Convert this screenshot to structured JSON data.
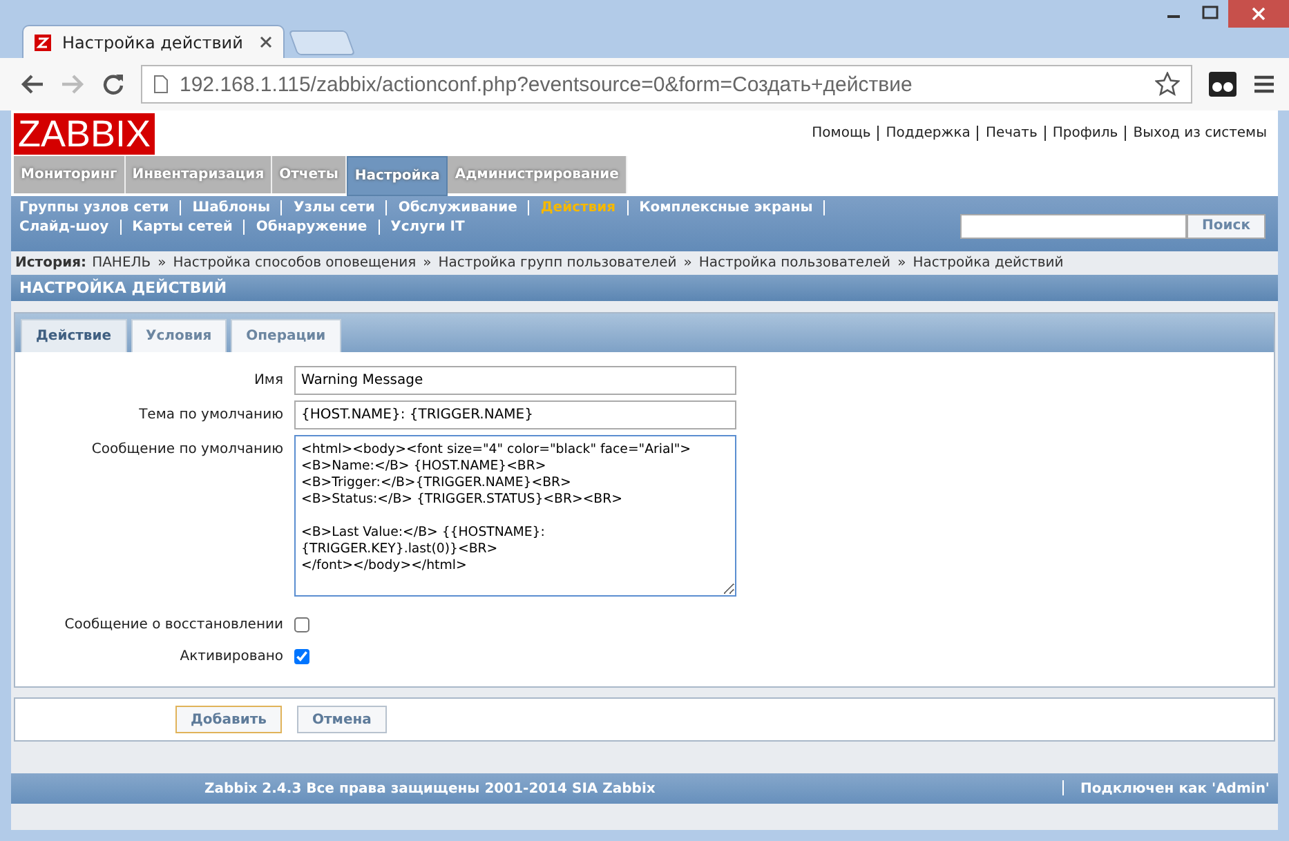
{
  "browser": {
    "tab_title": "Настройка действий",
    "url": "192.168.1.115/zabbix/actionconf.php?eventsource=0&form=Создать+действие"
  },
  "header": {
    "logo": "ZABBIX",
    "links": [
      "Помощь",
      "Поддержка",
      "Печать",
      "Профиль",
      "Выход из системы"
    ]
  },
  "main_menu": [
    {
      "label": "Мониторинг",
      "selected": false
    },
    {
      "label": "Инвентаризация",
      "selected": false
    },
    {
      "label": "Отчеты",
      "selected": false
    },
    {
      "label": "Настройка",
      "selected": true
    },
    {
      "label": "Администрирование",
      "selected": false
    }
  ],
  "sub_menu": [
    [
      {
        "label": "Группы узлов сети",
        "selected": false
      },
      {
        "label": "Шаблоны",
        "selected": false
      },
      {
        "label": "Узлы сети",
        "selected": false
      },
      {
        "label": "Обслуживание",
        "selected": false
      },
      {
        "label": "Действия",
        "selected": true
      },
      {
        "label": "Комплексные экраны",
        "selected": false
      }
    ],
    [
      {
        "label": "Слайд-шоу",
        "selected": false
      },
      {
        "label": "Карты сетей",
        "selected": false
      },
      {
        "label": "Обнаружение",
        "selected": false
      },
      {
        "label": "Услуги IT",
        "selected": false
      }
    ]
  ],
  "search": {
    "button": "Поиск"
  },
  "breadcrumbs": {
    "label": "История:",
    "separator": "»",
    "items": [
      "ПАНЕЛЬ",
      "Настройка способов оповещения",
      "Настройка групп пользователей",
      "Настройка пользователей",
      "Настройка действий"
    ]
  },
  "page_title": "НАСТРОЙКА ДЕЙСТВИЙ",
  "form": {
    "tabs": [
      {
        "label": "Действие",
        "selected": true
      },
      {
        "label": "Условия",
        "selected": false
      },
      {
        "label": "Операции",
        "selected": false
      }
    ],
    "fields": [
      {
        "kind": "text",
        "label": "Имя",
        "value": "Warning Message"
      },
      {
        "kind": "text",
        "label": "Тема по умолчанию",
        "value": "{HOST.NAME}: {TRIGGER.NAME}"
      },
      {
        "kind": "textarea",
        "label": "Сообщение по умолчанию",
        "value": "<html><body><font size=\"4\" color=\"black\" face=\"Arial\">\n<B>Name:</B> {HOST.NAME}<BR>\n<B>Trigger:</B>{TRIGGER.NAME}<BR>\n<B>Status:</B> {TRIGGER.STATUS}<BR><BR>\n\n<B>Last Value:</B> {{HOSTNAME}:\n{TRIGGER.KEY}.last(0)}<BR>\n</font></body></html>"
      },
      {
        "kind": "checkbox",
        "label": "Сообщение о восстановлении",
        "checked": false
      },
      {
        "kind": "checkbox",
        "label": "Активировано",
        "checked": true
      }
    ],
    "buttons": [
      {
        "label": "Добавить",
        "focused": true
      },
      {
        "label": "Отмена",
        "focused": false
      }
    ]
  },
  "footer": {
    "copyright": "Zabbix 2.4.3 Все права защищены 2001-2014 SIA Zabbix",
    "user": "Подключен как 'Admin'"
  }
}
